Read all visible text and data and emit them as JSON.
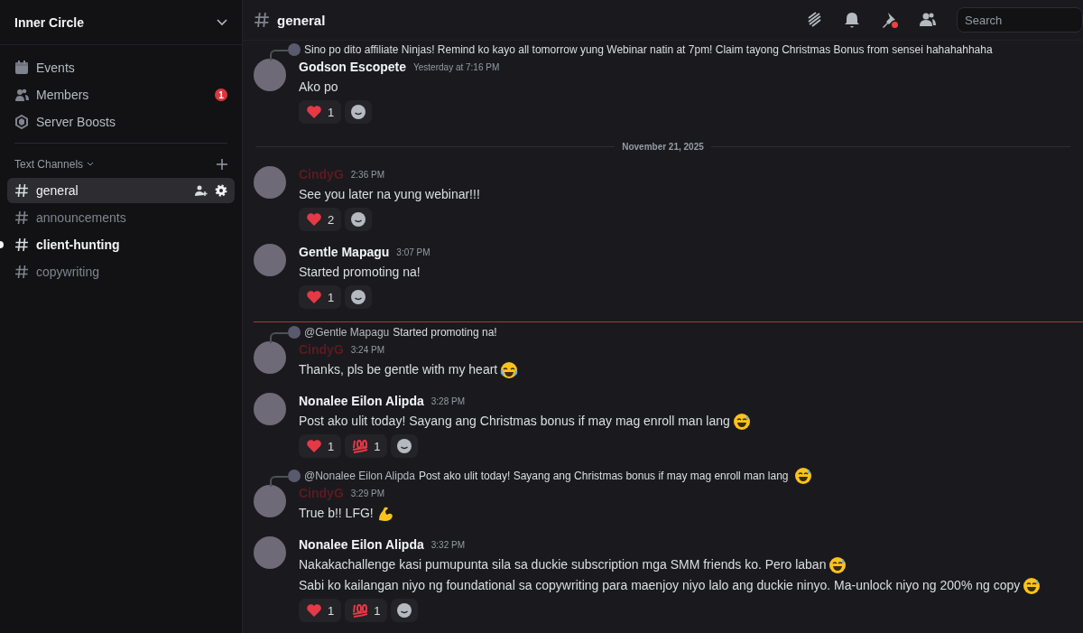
{
  "server": {
    "name": "Inner Circle"
  },
  "nav": [
    {
      "kind": "events",
      "label": "Events"
    },
    {
      "kind": "members",
      "label": "Members",
      "badge": "1"
    },
    {
      "kind": "boosts",
      "label": "Server Boosts"
    }
  ],
  "section": {
    "label": "Text Channels"
  },
  "channels": [
    {
      "name": "general",
      "selected": true,
      "unread": false
    },
    {
      "name": "announcements",
      "selected": false,
      "unread": false
    },
    {
      "name": "client-hunting",
      "selected": false,
      "unread": true
    },
    {
      "name": "copywriting",
      "selected": false,
      "unread": false
    }
  ],
  "header": {
    "channel": "general",
    "search_placeholder": "Search"
  },
  "feed": [
    {
      "kind": "message",
      "reply": {
        "text": "Sino po dito affiliate Ninjas! Remind ko kayo all tomorrow yung Webinar natin at 7pm! Claim tayong Christmas Bonus from sensei hahahahhaha"
      },
      "author": "Godson Escopete",
      "color": "#f2f3f5",
      "time": "Yesterday at 7:16 PM",
      "lines": [
        {
          "text": "Ako po"
        }
      ],
      "reactions": [
        {
          "kind": "heart",
          "count": "1"
        }
      ]
    },
    {
      "kind": "date",
      "label": "November 21, 2025"
    },
    {
      "kind": "message",
      "author": "CindyG",
      "color": "#5c1a22",
      "time": "2:36 PM",
      "lines": [
        {
          "text": "See you later na yung webinar!!!"
        }
      ],
      "reactions": [
        {
          "kind": "heart",
          "count": "2"
        }
      ]
    },
    {
      "kind": "message",
      "author": "Gentle Mapagu",
      "color": "#f2f3f5",
      "time": "3:07 PM",
      "lines": [
        {
          "text": "Started promoting na!"
        }
      ],
      "reactions": [
        {
          "kind": "heart",
          "count": "1"
        }
      ]
    },
    {
      "kind": "new"
    },
    {
      "kind": "message",
      "reply": {
        "author": "@Gentle Mapagu",
        "text": "Started promoting na!"
      },
      "author": "CindyG",
      "color": "#5c1a22",
      "time": "3:24 PM",
      "lines": [
        {
          "text": "Thanks, pls be gentle with my heart",
          "emoji": {
            "kind": "laugh"
          }
        }
      ]
    },
    {
      "kind": "message",
      "author": "Nonalee Eilon Alipda",
      "color": "#f2f3f5",
      "time": "3:28 PM",
      "lines": [
        {
          "text": "Post ako ulit today! Sayang ang Christmas bonus if may mag enroll man lang",
          "emoji": {
            "kind": "sweat"
          }
        }
      ],
      "reactions": [
        {
          "kind": "heart",
          "count": "1"
        },
        {
          "kind": "hundred",
          "count": "1"
        }
      ]
    },
    {
      "kind": "message",
      "reply": {
        "author": "@Nonalee Eilon Alipda",
        "text": "Post ako ulit today! Sayang ang Christmas bonus if may mag enroll man lang",
        "emoji": {
          "kind": "sweat"
        }
      },
      "author": "CindyG",
      "color": "#5c1a22",
      "time": "3:29 PM",
      "lines": [
        {
          "text": "True b!! LFG!",
          "emoji": {
            "kind": "muscle"
          }
        }
      ]
    },
    {
      "kind": "message",
      "author": "Nonalee Eilon Alipda",
      "color": "#f2f3f5",
      "time": "3:32 PM",
      "lines": [
        {
          "text": "Nakakachallenge kasi pumupunta sila sa duckie subscription mga SMM friends ko. Pero laban",
          "emoji": {
            "kind": "sweat"
          }
        },
        {
          "text": "Sabi ko kailangan niyo ng foundational sa copywriting para maenjoy niyo lalo ang duckie ninyo. Ma-unlock niyo ng 200% ng copy",
          "emoji": {
            "kind": "sweat"
          }
        }
      ],
      "reactions": [
        {
          "kind": "heart",
          "count": "1"
        },
        {
          "kind": "hundred",
          "count": "1"
        }
      ]
    }
  ]
}
